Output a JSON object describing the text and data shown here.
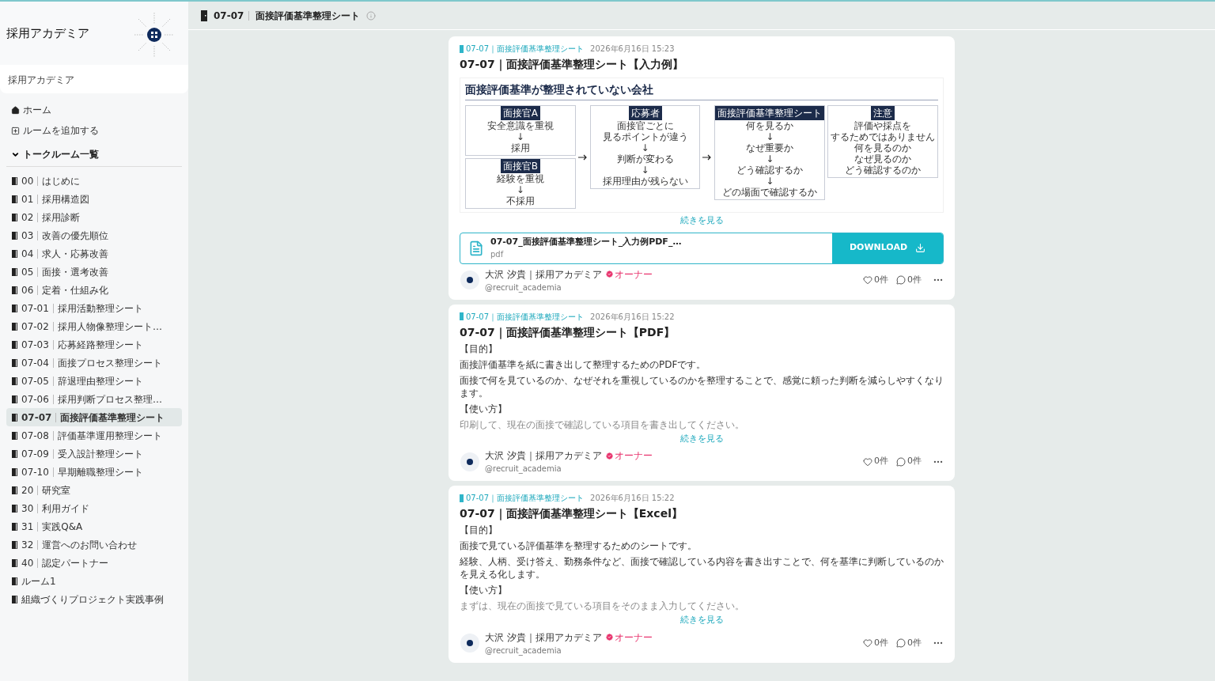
{
  "sidebar": {
    "logo_title": "採用アカデミア",
    "community_name": "採用アカデミア",
    "nav": [
      {
        "kind": "home",
        "label": "ホーム"
      },
      {
        "kind": "add",
        "label": "ルームを追加する"
      }
    ],
    "section_title": "トークルーム一覧",
    "rooms": [
      {
        "code": "00",
        "name": "はじめに",
        "selected": false
      },
      {
        "code": "01",
        "name": "採用構造図",
        "selected": false
      },
      {
        "code": "02",
        "name": "採用診断",
        "selected": false
      },
      {
        "code": "03",
        "name": "改善の優先順位",
        "selected": false
      },
      {
        "code": "04",
        "name": "求人・応募改善",
        "selected": false
      },
      {
        "code": "05",
        "name": "面接・選考改善",
        "selected": false
      },
      {
        "code": "06",
        "name": "定着・仕組み化",
        "selected": false
      },
      {
        "code": "07-01",
        "name": "採用活動整理シート",
        "selected": false
      },
      {
        "code": "07-02",
        "name": "採用人物像整理シート…",
        "selected": false
      },
      {
        "code": "07-03",
        "name": "応募経路整理シート",
        "selected": false
      },
      {
        "code": "07-04",
        "name": "面接プロセス整理シート",
        "selected": false
      },
      {
        "code": "07-05",
        "name": "辞退理由整理シート",
        "selected": false
      },
      {
        "code": "07-06",
        "name": "採用判断プロセス整理…",
        "selected": false
      },
      {
        "code": "07-07",
        "name": "面接評価基準整理シート",
        "selected": true
      },
      {
        "code": "07-08",
        "name": "評価基準運用整理シート",
        "selected": false
      },
      {
        "code": "07-09",
        "name": "受入設計整理シート",
        "selected": false
      },
      {
        "code": "07-10",
        "name": "早期離職整理シート",
        "selected": false
      },
      {
        "code": "20",
        "name": "研究室",
        "selected": false
      },
      {
        "code": "30",
        "name": "利用ガイド",
        "selected": false
      },
      {
        "code": "31",
        "name": "実践Q&A",
        "selected": false
      },
      {
        "code": "32",
        "name": "運営へのお問い合わせ",
        "selected": false
      },
      {
        "code": "40",
        "name": "認定パートナー",
        "selected": false
      },
      {
        "name": "ルーム1",
        "selected": false
      },
      {
        "name": "組織づくりプロジェクト実践事例",
        "selected": false
      }
    ]
  },
  "header": {
    "code": "07-07",
    "title": "面接評価基準整理シート"
  },
  "posts": [
    {
      "room": "07-07｜面接評価基準整理シート",
      "date": "2026年6月16日 15:23",
      "title": "07-07｜面接評価基準整理シート【入力例】",
      "kind": "preview",
      "preview": {
        "heading": "面接評価基準が整理されていない会社",
        "columns": [
          {
            "boxes": [
              {
                "tag": "面接官A",
                "lines": [
                  "安全意識を重視",
                  "↓",
                  "採用"
                ]
              },
              {
                "tag": "面接官B",
                "lines": [
                  "経験を重視",
                  "↓",
                  "不採用"
                ]
              }
            ]
          },
          {
            "boxes": [
              {
                "tag": "応募者",
                "lines": [
                  "面接官ごとに",
                  "見るポイントが違う",
                  "↓",
                  "判断が変わる",
                  "↓",
                  "採用理由が残らない"
                ]
              }
            ]
          },
          {
            "boxes": [
              {
                "tag": "面接評価基準整理シート",
                "lines": [
                  "何を見るか",
                  "↓",
                  "なぜ重要か",
                  "↓",
                  "どう確認するか",
                  "↓",
                  "どの場面で確認するか"
                ]
              }
            ]
          },
          {
            "boxes": [
              {
                "tag": "注意",
                "lines": [
                  "評価や採点を",
                  "するためではありません",
                  "何を見るのか",
                  "なぜ見るのか",
                  "どう確認するのか"
                ]
              }
            ]
          }
        ]
      },
      "more": "続きを見る",
      "file": {
        "name": "07-07_面接評価基準整理シート_入力例PDF_…",
        "ext": "pdf",
        "button": "DOWNLOAD"
      },
      "author": "大沢 汐貴｜採用アカデミア",
      "badge": "オーナー",
      "handle": "@recruit_academia",
      "likes": "0件",
      "comments": "0件"
    },
    {
      "room": "07-07｜面接評価基準整理シート",
      "date": "2026年6月16日 15:22",
      "title": "07-07｜面接評価基準整理シート【PDF】",
      "kind": "text",
      "paragraphs": [
        "【目的】",
        "面接評価基準を紙に書き出して整理するためのPDFです。",
        "面接で何を見ているのか、なぜそれを重視しているのかを整理することで、感覚に頼った判断を減らしやすくなります。",
        "【使い方】"
      ],
      "faded": "印刷して、現在の面接で確認している項目を書き出してください。",
      "more": "続きを見る",
      "author": "大沢 汐貴｜採用アカデミア",
      "badge": "オーナー",
      "handle": "@recruit_academia",
      "likes": "0件",
      "comments": "0件"
    },
    {
      "room": "07-07｜面接評価基準整理シート",
      "date": "2026年6月16日 15:22",
      "title": "07-07｜面接評価基準整理シート【Excel】",
      "kind": "text",
      "paragraphs": [
        "【目的】",
        "面接で見ている評価基準を整理するためのシートです。",
        "経験、人柄、受け答え、勤務条件など、面接で確認している内容を書き出すことで、何を基準に判断しているのかを見える化します。",
        "【使い方】"
      ],
      "faded": "まずは、現在の面接で見ている項目をそのまま入力してください。",
      "more": "続きを見る",
      "author": "大沢 汐貴｜採用アカデミア",
      "badge": "オーナー",
      "handle": "@recruit_academia",
      "likes": "0件",
      "comments": "0件"
    }
  ]
}
